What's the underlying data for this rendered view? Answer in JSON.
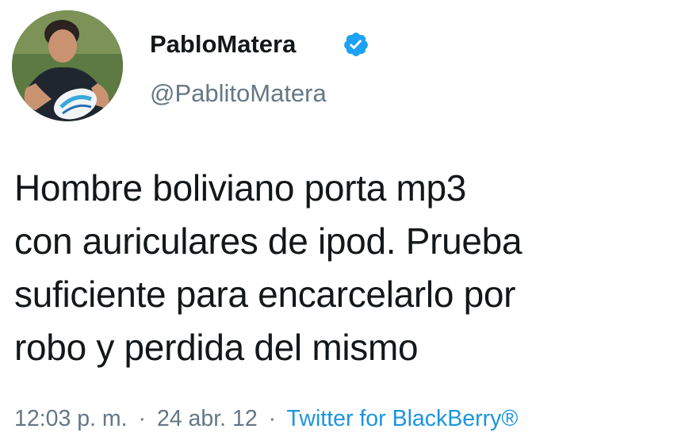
{
  "tweet": {
    "author": {
      "display_name": "PabloMatera",
      "username": "@PablitoMatera",
      "verified": true,
      "verified_icon": "verified-badge-icon",
      "avatar": "avatar-photo"
    },
    "text": "Hombre boliviano porta mp3\ncon auriculares de ipod. Prueba\nsuficiente para encarcelarlo por\nrobo y perdida del mismo",
    "meta": {
      "time": "12:03 p. m.",
      "separator": "·",
      "date": "24 abr. 12",
      "source": "Twitter for BlackBerry®"
    }
  },
  "colors": {
    "text_primary": "#14171a",
    "text_secondary": "#657786",
    "link": "#1b95e0",
    "verified_badge": "#1da1f2"
  }
}
